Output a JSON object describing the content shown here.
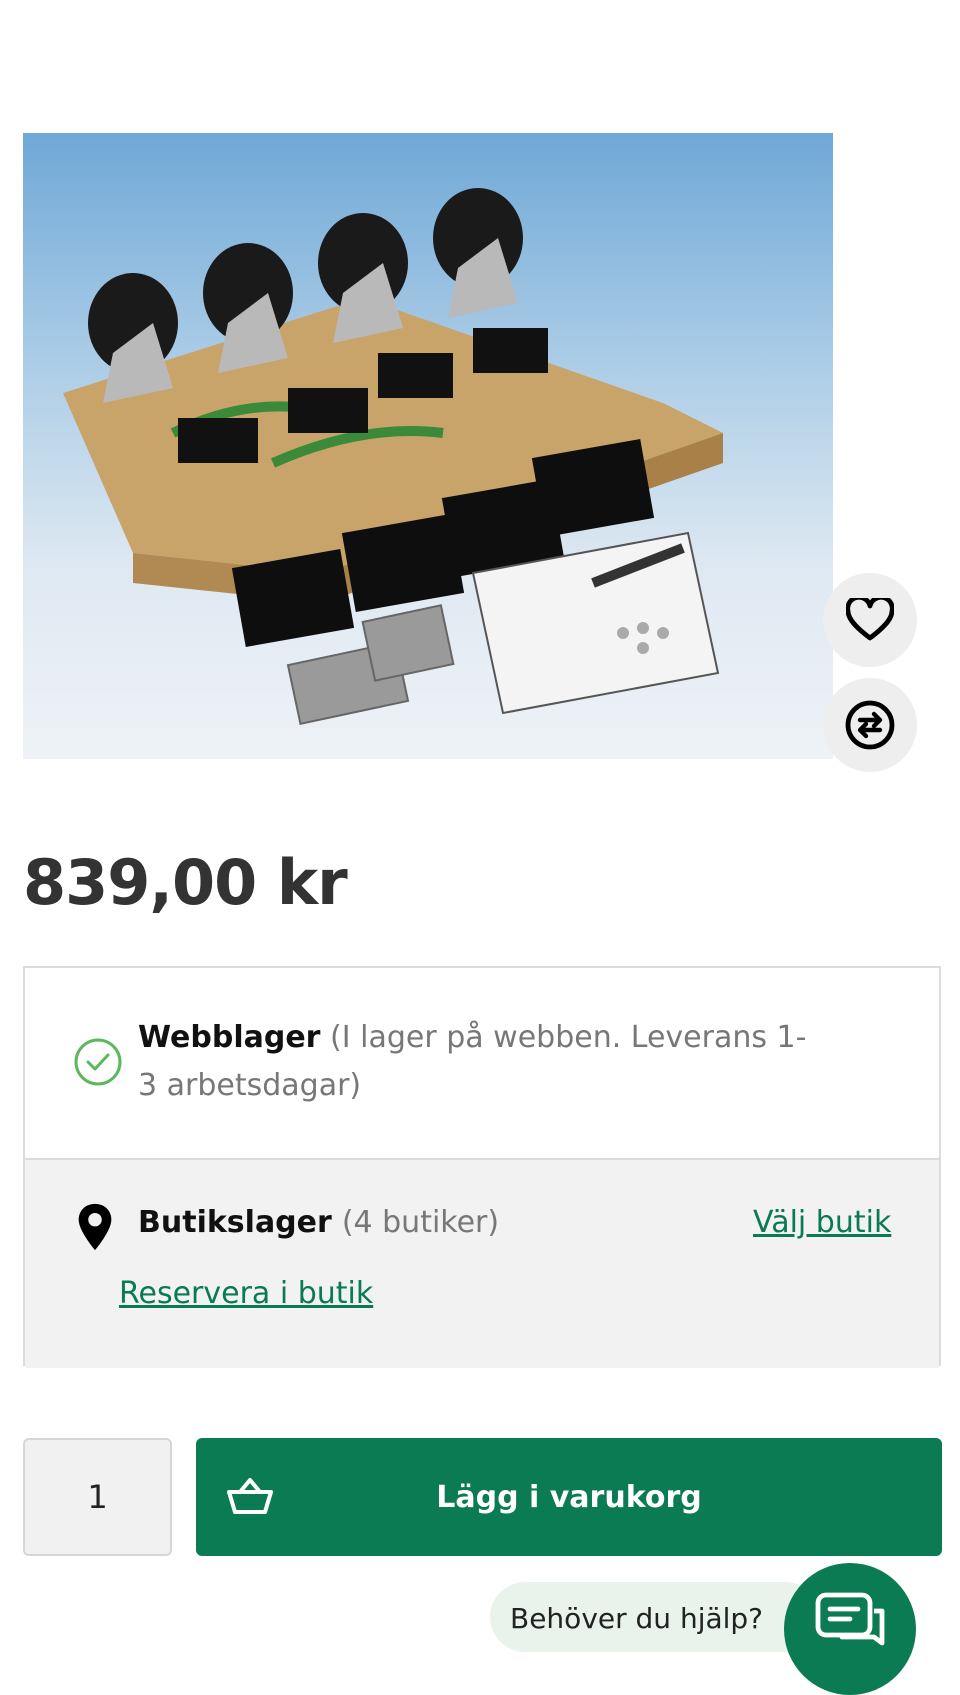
{
  "product": {
    "image_alt": "product-photo-casters-kit",
    "price": "839,00 kr"
  },
  "actions": {
    "favorite_icon": "heart-icon",
    "compare_icon": "compare-arrows-icon"
  },
  "stock": {
    "web_title": "Webblager",
    "web_detail": "(I lager på webben. Leverans 1-3 arbetsdagar)",
    "store_title": "Butikslager",
    "store_count": "(4 butiker)",
    "choose_store": "Välj butik",
    "reserve": "Reservera i butik"
  },
  "cart": {
    "quantity": "1",
    "add_label": "Lägg i varukorg"
  },
  "help": {
    "label": "Behöver du hjälp?"
  },
  "colors": {
    "brand_green": "#0b7b53",
    "link_green": "#0a7a52",
    "check_green": "#5cb85c"
  }
}
